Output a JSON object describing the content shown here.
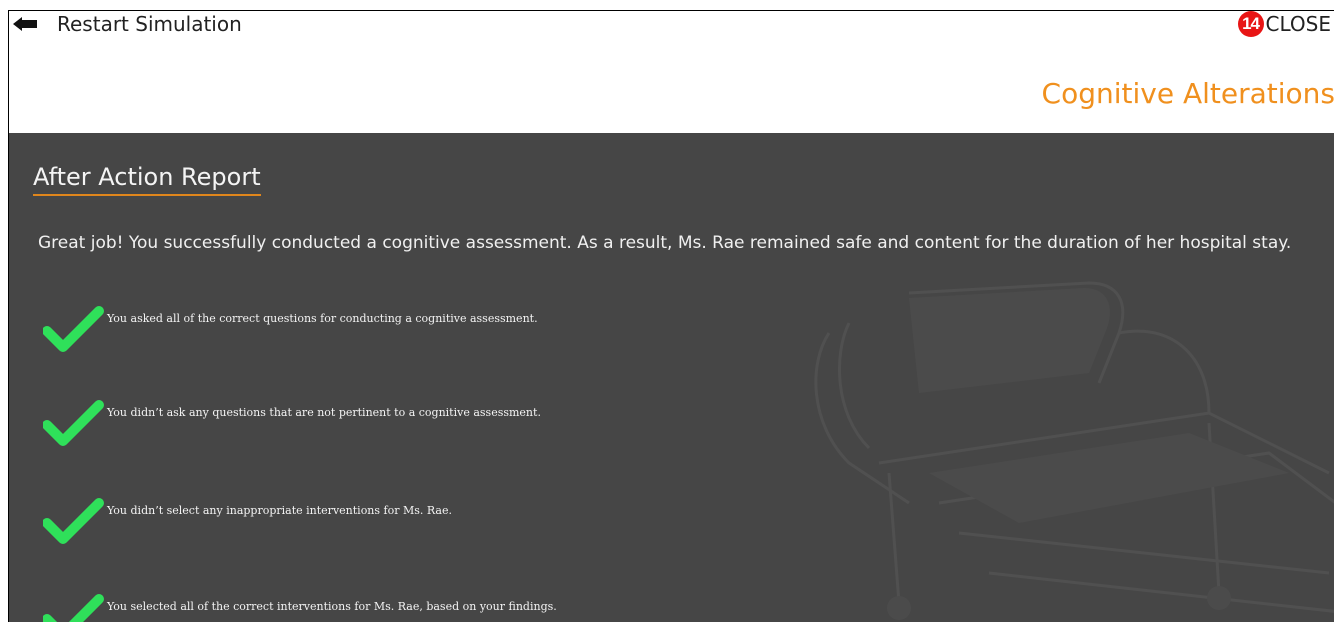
{
  "header": {
    "restart_label": "Restart Simulation",
    "close_badge": "14",
    "close_label": "CLOSE",
    "module_title": "Cognitive Alterations"
  },
  "report": {
    "title": "After Action Report",
    "summary": "Great job! You successfully conducted a cognitive assessment. As a result, Ms. Rae remained safe and content for the duration of her hospital stay.",
    "items": [
      {
        "text": "You asked all of the correct questions for conducting a cognitive assessment.",
        "icon": "check-icon"
      },
      {
        "text": "You didn’t ask any questions that are not pertinent to a cognitive assessment.",
        "icon": "check-icon"
      },
      {
        "text": "You didn’t select any inappropriate interventions for Ms. Rae.",
        "icon": "check-icon"
      },
      {
        "text": "You selected all of the correct interventions for Ms. Rae, based on your findings.",
        "icon": "check-icon"
      }
    ]
  },
  "colors": {
    "accent_orange": "#f0901e",
    "panel_bg": "#464646",
    "check_green": "#2fe05a",
    "badge_red": "#e81515"
  }
}
